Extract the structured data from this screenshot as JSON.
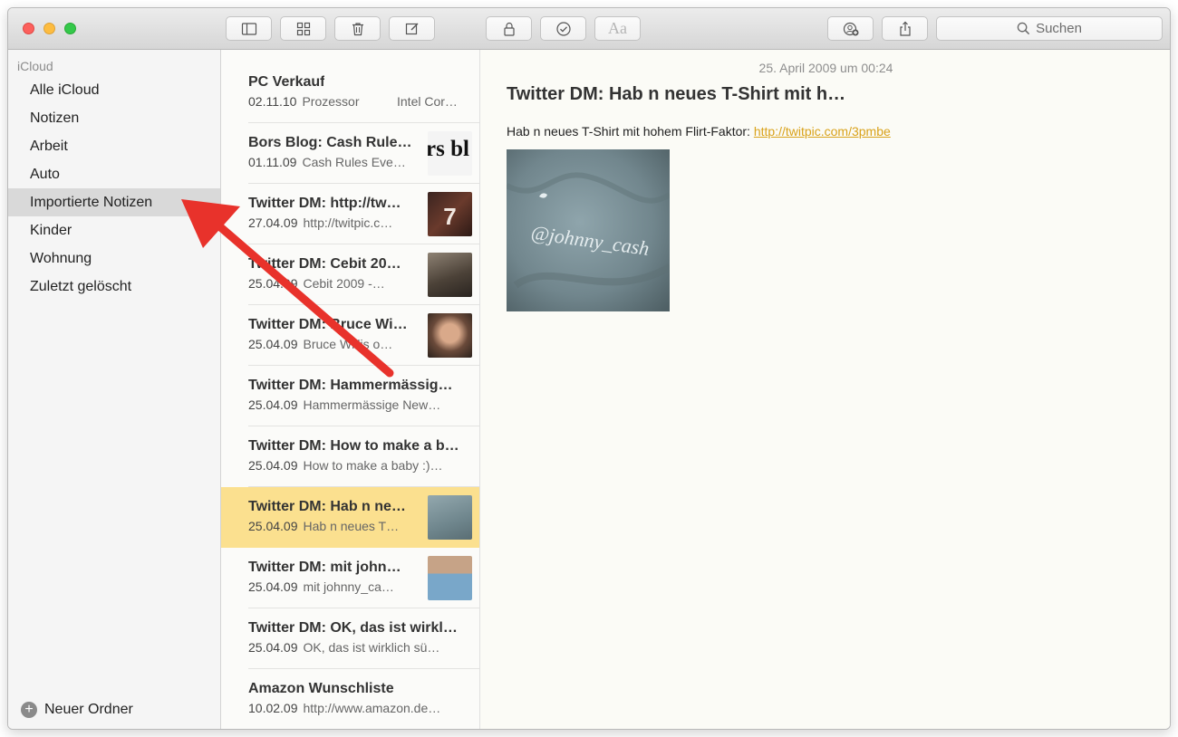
{
  "toolbar": {
    "search_placeholder": "Suchen",
    "format_label": "Aa"
  },
  "sidebar": {
    "section_title": "iCloud",
    "items": [
      {
        "label": "Alle iCloud"
      },
      {
        "label": "Notizen"
      },
      {
        "label": "Arbeit"
      },
      {
        "label": "Auto"
      },
      {
        "label": "Importierte Notizen",
        "selected": true
      },
      {
        "label": "Kinder"
      },
      {
        "label": "Wohnung"
      },
      {
        "label": "Zuletzt gelöscht"
      }
    ],
    "new_folder_label": "Neuer Ordner"
  },
  "notes": [
    {
      "title": "PC Verkauf",
      "date": "02.11.10",
      "preview": "Prozessor",
      "preview2": "Intel Cor…"
    },
    {
      "title": "Bors Blog: Cash Rule…",
      "date": "01.11.09",
      "preview": "Cash Rules Eve…",
      "thumb_text": "rs bl"
    },
    {
      "title": "Twitter DM: http://tw…",
      "date": "27.04.09",
      "preview": "http://twitpic.c…",
      "thumb_text": "7"
    },
    {
      "title": "Twitter DM: Cebit 20…",
      "date": "25.04.09",
      "preview": "Cebit 2009 -…"
    },
    {
      "title": "Twitter DM: Bruce Wi…",
      "date": "25.04.09",
      "preview": "Bruce Willis o…"
    },
    {
      "title": "Twitter DM: Hammermässig…",
      "date": "25.04.09",
      "preview": "Hammermässige New…"
    },
    {
      "title": "Twitter DM: How to make a b…",
      "date": "25.04.09",
      "preview": "How to make a baby :)…"
    },
    {
      "title": "Twitter DM: Hab n ne…",
      "date": "25.04.09",
      "preview": "Hab n neues T…",
      "selected": true
    },
    {
      "title": "Twitter DM: mit john…",
      "date": "25.04.09",
      "preview": "mit johnny_ca…"
    },
    {
      "title": "Twitter DM: OK, das ist wirkl…",
      "date": "25.04.09",
      "preview": "OK, das ist wirklich sü…"
    },
    {
      "title": "Amazon Wunschliste",
      "date": "10.02.09",
      "preview": "http://www.amazon.de…"
    }
  ],
  "note": {
    "date": "25. April 2009 um 00:24",
    "title": "Twitter DM: Hab n neues T-Shirt mit h…",
    "body_text": "Hab n neues T-Shirt mit hohem Flirt-Faktor: ",
    "link_text": "http://twitpic.com/3pmbe",
    "image_caption": "@johnny_cash"
  },
  "colors": {
    "selected_note": "#fbe08f",
    "selected_folder": "#d9d9d9",
    "link": "#d9a21a",
    "annotation_arrow": "#e8322b"
  }
}
